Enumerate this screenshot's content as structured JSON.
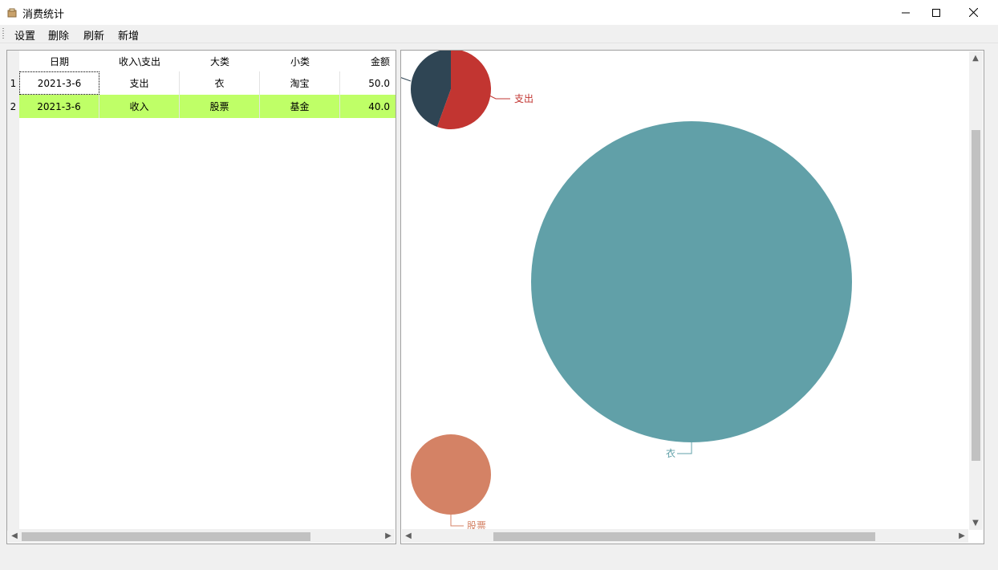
{
  "window": {
    "title": "消费统计"
  },
  "menu": {
    "items": [
      "设置",
      "删除",
      "刷新",
      "新增"
    ]
  },
  "table": {
    "columns": [
      "日期",
      "收入\\支出",
      "大类",
      "小类",
      "金额"
    ],
    "rows": [
      {
        "num": "1",
        "cells": [
          "2021-3-6",
          "支出",
          "衣",
          "淘宝",
          "50.0"
        ]
      },
      {
        "num": "2",
        "cells": [
          "2021-3-6",
          "收入",
          "股票",
          "基金",
          "40.0"
        ]
      }
    ],
    "highlight_color": "#bfff67"
  },
  "charts": {
    "pie_top": {
      "label": "支出",
      "label_color": "#c23531",
      "slice_colors": [
        "#c23531",
        "#2f4554"
      ]
    },
    "pie_big": {
      "label": "衣",
      "color": "#61a0a8"
    },
    "pie_small": {
      "label": "股票",
      "color": "#d48265"
    }
  },
  "chart_data": [
    {
      "type": "pie",
      "slices": [
        {
          "name": "支出",
          "value": 50.0
        },
        {
          "value": 40.0
        }
      ]
    },
    {
      "type": "pie",
      "slices": [
        {
          "name": "衣",
          "value": 50.0
        }
      ]
    },
    {
      "type": "pie",
      "slices": [
        {
          "name": "股票",
          "value": 40.0
        }
      ]
    }
  ]
}
